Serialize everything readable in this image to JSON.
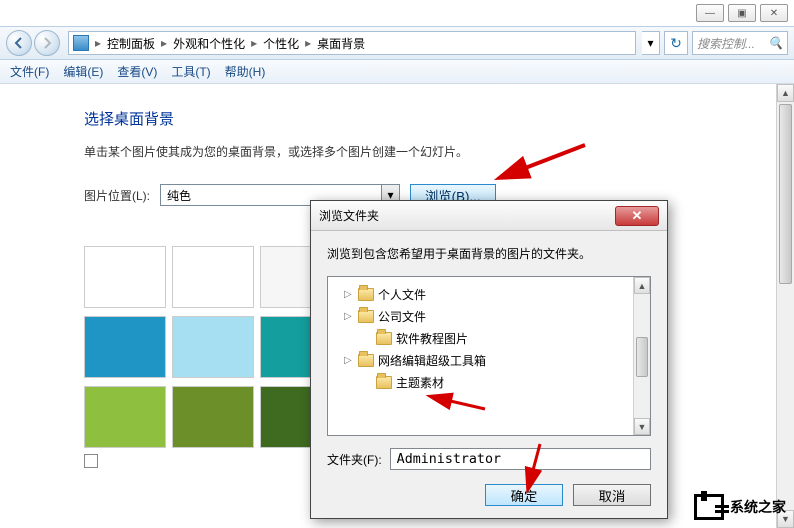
{
  "window_controls": {
    "min": "—",
    "max": "▣",
    "close": "✕"
  },
  "breadcrumb": {
    "items": [
      "控制面板",
      "外观和个性化",
      "个性化",
      "桌面背景"
    ]
  },
  "search": {
    "placeholder": "搜索控制..."
  },
  "menubar": [
    "文件(F)",
    "编辑(E)",
    "查看(V)",
    "工具(T)",
    "帮助(H)"
  ],
  "page": {
    "title": "选择桌面背景",
    "subtitle": "单击某个图片使其成为您的桌面背景，或选择多个图片创建一个幻灯片。",
    "location_label": "图片位置(L):",
    "location_value": "纯色",
    "browse_btn": "浏览(B)..."
  },
  "swatches": [
    [
      "#000000",
      "#ffffff",
      "#f6f6f6"
    ],
    [
      "#1f95c6",
      "#a7dff2",
      "#149e9e"
    ],
    [
      "#8fbf3f",
      "#6d8f2a",
      "#3e6b1f"
    ]
  ],
  "dialog": {
    "title": "浏览文件夹",
    "message": "浏览到包含您希望用于桌面背景的图片的文件夹。",
    "tree": [
      {
        "label": "个人文件",
        "expandable": true,
        "indent": false
      },
      {
        "label": "公司文件",
        "expandable": true,
        "indent": false
      },
      {
        "label": "软件教程图片",
        "expandable": false,
        "indent": true
      },
      {
        "label": "网络编辑超级工具箱",
        "expandable": true,
        "indent": false
      },
      {
        "label": "主题素材",
        "expandable": false,
        "indent": true
      }
    ],
    "folder_label": "文件夹(F):",
    "folder_value": "Administrator",
    "ok": "确定",
    "cancel": "取消"
  },
  "watermark": "系统之家"
}
